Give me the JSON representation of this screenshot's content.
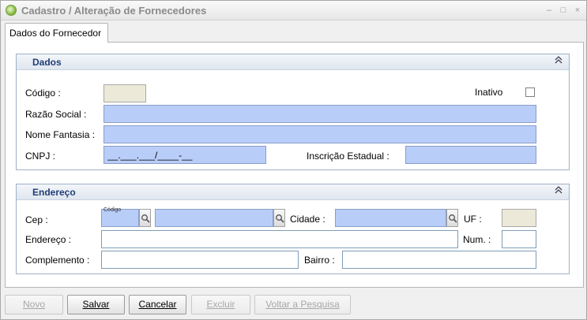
{
  "window": {
    "title": "Cadastro / Alteração de Fornecedores",
    "controls": {
      "minimize": "–",
      "maximize": "□",
      "close": "×"
    }
  },
  "tab": {
    "label": "Dados do Fornecedor"
  },
  "dados": {
    "title": "Dados",
    "collapse_icon": "chevron-double-up-icon",
    "codigo_label": "Código :",
    "codigo_value": "",
    "inativo_label": "Inativo",
    "inativo_checked": false,
    "razao_label": "Razão Social :",
    "razao_value": "",
    "fantasia_label": "Nome Fantasia :",
    "fantasia_value": "",
    "cnpj_label": "CNPJ :",
    "cnpj_value": "__.___.___/____-__",
    "ie_label": "Inscrição Estadual :",
    "ie_value": ""
  },
  "endereco": {
    "title": "Endereço",
    "collapse_icon": "chevron-double-up-icon",
    "cep_label": "Cep :",
    "cep_hint": "Código",
    "cep_value": "",
    "logradouro_value": "",
    "cidade_label": "Cidade :",
    "cidade_value": "",
    "uf_label": "UF :",
    "uf_value": "",
    "endereco_label": "Endereço :",
    "endereco_value": "",
    "num_label": "Num. :",
    "num_value": "",
    "complemento_label": "Complemento :",
    "complemento_value": "",
    "bairro_label": "Bairro :",
    "bairro_value": ""
  },
  "buttons": {
    "novo": "Novo",
    "salvar": "Salvar",
    "cancelar": "Cancelar",
    "excluir": "Excluir",
    "voltar": "Voltar a Pesquisa"
  },
  "colors": {
    "required_field": "#b9cdf9",
    "readonly_field": "#ece9d8",
    "group_title": "#1f3d77"
  }
}
